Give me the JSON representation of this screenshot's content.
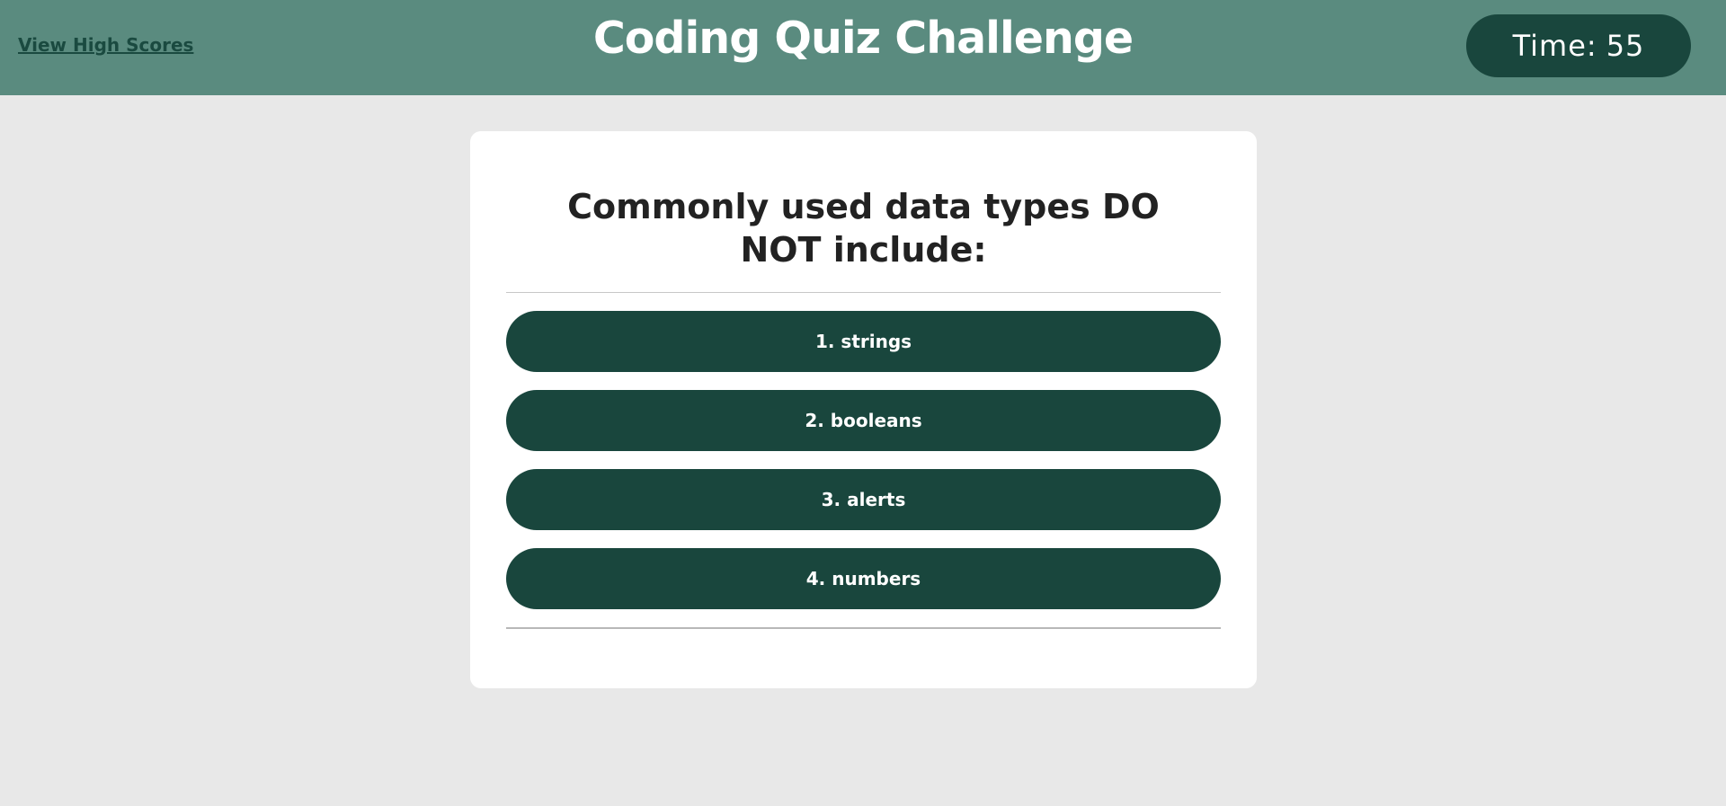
{
  "header": {
    "high_scores_label": "View High Scores",
    "title": "Coding Quiz Challenge",
    "timer_label": "Time:",
    "timer_value": "55"
  },
  "question": {
    "text": "Commonly used data types DO NOT include:",
    "choices": [
      {
        "label": "1. strings"
      },
      {
        "label": "2. booleans"
      },
      {
        "label": "3. alerts"
      },
      {
        "label": "4. numbers"
      }
    ]
  },
  "colors": {
    "header_bg": "#5a8b7f",
    "accent_dark": "#19463d",
    "page_bg": "#e8e8e8",
    "card_bg": "#ffffff"
  }
}
